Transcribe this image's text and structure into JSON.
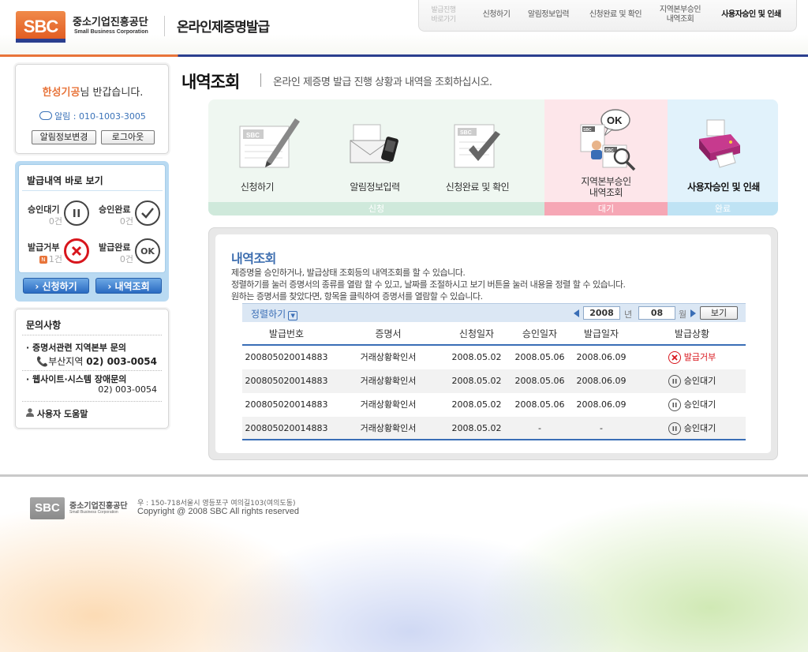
{
  "header": {
    "logo_text": "SBC",
    "org_name_ko": "중소기업진흥공단",
    "org_name_en": "Small Business Corporation",
    "site_title": "온라인제증명발급",
    "nav": [
      {
        "label": "발급진행\n바로가기",
        "kind": "shortcut"
      },
      {
        "label": "신청하기",
        "kind": "normal"
      },
      {
        "label": "알림정보입력",
        "kind": "normal"
      },
      {
        "label": "신청완료 및 확인",
        "kind": "normal"
      },
      {
        "label": "지역본부승인\n내역조회",
        "kind": "normal"
      },
      {
        "label": "사용자승인 및 인쇄",
        "kind": "active"
      }
    ]
  },
  "sidebar": {
    "user_name": "한성기공",
    "greeting_suffix": "님 반갑습니다.",
    "alarm": "알림 : 010-1003-3005",
    "change_alarm_button": "알림정보변경",
    "logout_button": "로그아웃",
    "quick": {
      "title": "발급내역 바로 보기",
      "stats": [
        {
          "label": "승인대기",
          "count": "0건"
        },
        {
          "label": "승인완료",
          "count": "0건"
        },
        {
          "label": "발급거부",
          "count": "1건",
          "badge": "N"
        },
        {
          "label": "발급완료",
          "count": "0건"
        }
      ],
      "ok_text": "OK",
      "apply_button": "› 신청하기",
      "history_button": "› 내역조회"
    },
    "inquiry": {
      "title": "문의사항",
      "cert_item": "· 증명서관련 지역본부 문의",
      "cert_region": "부산지역",
      "cert_phone": "02) 003-0054",
      "web_item": "· 웹사이트·시스템 장애문의",
      "web_phone": "02) 003-0054",
      "help": "사용자 도움말"
    }
  },
  "main": {
    "title": "내역조회",
    "subtitle": "온라인 제증명 발급 진행 상황과 내역을 조회하십시오.",
    "steps": [
      {
        "label": "신청하기"
      },
      {
        "label": "알림정보입력"
      },
      {
        "label": "신청완료 및 확인"
      },
      {
        "label": "지역본부승인\n내역조회"
      },
      {
        "label": "사용자승인 및 인쇄"
      }
    ],
    "phases": [
      {
        "label": "신청",
        "color": "#cfe9db"
      },
      {
        "label": "대기",
        "color": "#f6a7b5"
      },
      {
        "label": "완료",
        "color": "#bfe3f4"
      }
    ],
    "list": {
      "title": "내역조회",
      "desc": [
        "제증명을 승인하거나, 발급상태 조회등의 내역조회를 할 수 있습니다.",
        "정렬하기를 눌러 증명서의 종류를 열람 할 수 있고, 날짜를 조절하시고 보기 버튼을 눌러 내용을 정렬 할 수 있습니다.",
        "원하는 증명서를 찾았다면, 항목을 클릭하여 증명서를 열람할 수 있습니다."
      ],
      "sort_label": "정렬하기",
      "year": "2008",
      "year_unit": "년",
      "month": "08",
      "month_unit": "월",
      "view_button": "보기",
      "columns": [
        "발급번호",
        "증명서",
        "신청일자",
        "승인일자",
        "발급일자",
        "발급상황"
      ],
      "rows": [
        {
          "no": "200805020014883",
          "cert": "거래상황확인서",
          "applied": "2008.05.02",
          "approved": "2008.05.06",
          "issued": "2008.06.09",
          "status": "발급거부",
          "status_type": "rejected"
        },
        {
          "no": "200805020014883",
          "cert": "거래상황확인서",
          "applied": "2008.05.02",
          "approved": "2008.05.06",
          "issued": "2008.06.09",
          "status": "승인대기",
          "status_type": "waiting"
        },
        {
          "no": "200805020014883",
          "cert": "거래상황확인서",
          "applied": "2008.05.02",
          "approved": "2008.05.06",
          "issued": "2008.06.09",
          "status": "승인대기",
          "status_type": "waiting"
        },
        {
          "no": "200805020014883",
          "cert": "거래상황확인서",
          "applied": "2008.05.02",
          "approved": "-",
          "issued": "-",
          "status": "승인대기",
          "status_type": "waiting"
        }
      ]
    }
  },
  "footer": {
    "logo_text": "SBC",
    "org_ko": "중소기업진흥공단",
    "org_en": "Small Business Corporation",
    "address": "우 : 150-718서울시 영등포구 여의길103(여의도동)",
    "copyright": "Copyright @ 2008 SBC All rights reserved"
  },
  "colors": {
    "brand_orange": "#e8743a",
    "brand_navy": "#2b3f8f",
    "accent_blue": "#3a6eb6",
    "reject_red": "#d8161d"
  }
}
